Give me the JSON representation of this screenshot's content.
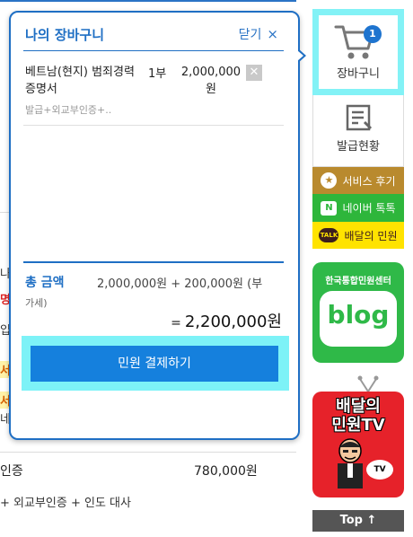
{
  "background": {
    "fragments": [
      "나",
      "명",
      "입",
      "서",
      "서",
      "네"
    ],
    "row_title": "인증",
    "row_price": "780,000원",
    "row_sub": "+ 외교부인증 + 인도 대사"
  },
  "cart": {
    "title": "나의 장바구니",
    "close_label": "닫기",
    "close_icon": "×",
    "item": {
      "name": "베트남(현지) 범죄경력증명서",
      "qty": "1부",
      "price": "2,000,000원",
      "options": "발급+외교부인증+.."
    },
    "total_label": "총 금액",
    "total_sum": "2,000,000원 + 200,000원 (부",
    "total_note": "가세)",
    "grand_eq": "=",
    "grand_total": "2,200,000원",
    "pay_label": "민원 결제하기"
  },
  "quick_menu": {
    "cart_label": "장바구니",
    "cart_count": "1",
    "issue_label": "발급현황",
    "review_label": "서비스 후기",
    "naver_label": "네이버 톡톡",
    "naver_icon_text": "N",
    "kakao_label": "배달의 민원",
    "kakao_icon_text": "TALK",
    "blog_top": "한국통합민원센터",
    "blog_text": "blog",
    "tv_title_1": "배달의",
    "tv_title_2": "민원TV",
    "tv_badge": "TV",
    "top_label": "Top ↑"
  },
  "colors": {
    "accent": "#1f6fc4",
    "highlight": "#7df2f7",
    "pay_button": "#1580dd",
    "review": "#b98a2e",
    "naver": "#2eb63b",
    "kakao": "#ffe300",
    "blog": "#2fb948",
    "tv": "#e6222a"
  }
}
